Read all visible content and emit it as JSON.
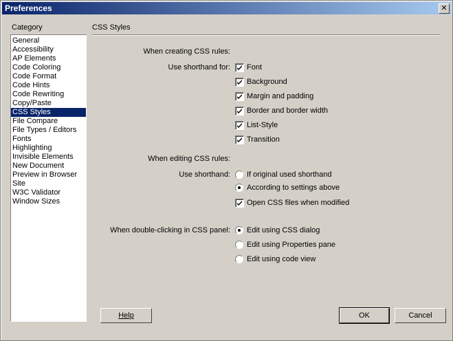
{
  "window": {
    "title": "Preferences",
    "close_glyph": "✕"
  },
  "sidebar": {
    "label": "Category",
    "items": [
      {
        "label": "General"
      },
      {
        "label": "Accessibility"
      },
      {
        "label": "AP Elements"
      },
      {
        "label": "Code Coloring"
      },
      {
        "label": "Code Format"
      },
      {
        "label": "Code Hints"
      },
      {
        "label": "Code Rewriting"
      },
      {
        "label": "Copy/Paste"
      },
      {
        "label": "CSS Styles",
        "selected": true
      },
      {
        "label": "File Compare"
      },
      {
        "label": "File Types / Editors"
      },
      {
        "label": "Fonts"
      },
      {
        "label": "Highlighting"
      },
      {
        "label": "Invisible Elements"
      },
      {
        "label": "New Document"
      },
      {
        "label": "Preview in Browser"
      },
      {
        "label": "Site"
      },
      {
        "label": "W3C Validator"
      },
      {
        "label": "Window Sizes"
      }
    ]
  },
  "main": {
    "section_title": "CSS Styles",
    "creating_label": "When creating CSS rules:",
    "shorthand_for_label": "Use shorthand for:",
    "shorthand_options": [
      {
        "label": "Font",
        "checked": true
      },
      {
        "label": "Background",
        "checked": true
      },
      {
        "label": "Margin and padding",
        "checked": true
      },
      {
        "label": "Border and border width",
        "checked": true
      },
      {
        "label": "List-Style",
        "checked": true
      },
      {
        "label": "Transition",
        "checked": true
      }
    ],
    "editing_label": "When editing CSS rules:",
    "use_shorthand_label": "Use shorthand:",
    "shorthand_radio": [
      {
        "label": "If original used shorthand",
        "selected": false
      },
      {
        "label": "According to settings above",
        "selected": true
      }
    ],
    "open_css_files_label": "Open CSS files when modified",
    "open_css_files_checked": true,
    "dblclick_label": "When double-clicking in CSS panel:",
    "dblclick_radio": [
      {
        "label": "Edit using CSS dialog",
        "selected": true
      },
      {
        "label": "Edit using Properties pane",
        "selected": false
      },
      {
        "label": "Edit using code view",
        "selected": false
      }
    ]
  },
  "buttons": {
    "help": "Help",
    "ok": "OK",
    "cancel": "Cancel"
  }
}
